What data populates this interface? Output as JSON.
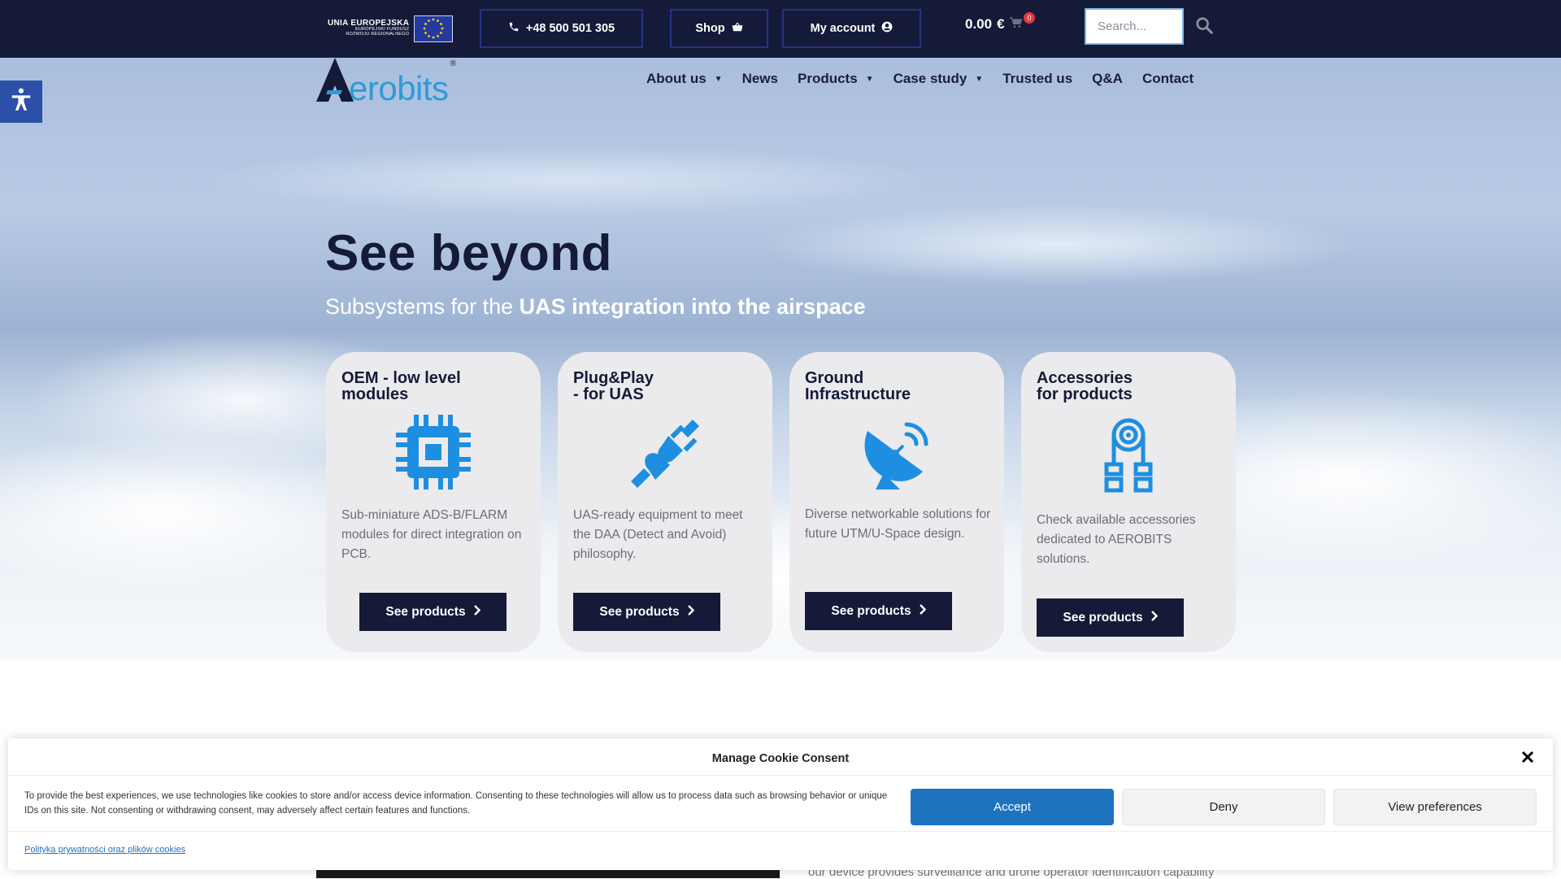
{
  "topbar": {
    "eu_title": "UNIA EUROPEJSKA",
    "eu_subtitle_1": "EUROPEJSKI FUNDUSZ",
    "eu_subtitle_2": "ROZWOJU REGIONALNEGO",
    "phone_label": "+48 500 501 305",
    "shop_label": "Shop",
    "account_label": "My account",
    "cart_total": "0.00",
    "cart_currency": "€",
    "cart_count": "0",
    "search_placeholder": "Search..."
  },
  "brand": {
    "logo_text": "erobits",
    "registered": "®"
  },
  "nav": [
    {
      "label": "About us",
      "has_dropdown": true
    },
    {
      "label": "News",
      "has_dropdown": false
    },
    {
      "label": "Products",
      "has_dropdown": true
    },
    {
      "label": "Case study",
      "has_dropdown": true
    },
    {
      "label": "Trusted us",
      "has_dropdown": false
    },
    {
      "label": "Q&A",
      "has_dropdown": false
    },
    {
      "label": "Contact",
      "has_dropdown": false
    }
  ],
  "hero": {
    "headline": "See beyond",
    "subline_prefix": "Subsystems for the ",
    "subline_bold": "UAS integration into the airspace"
  },
  "cards": [
    {
      "title_1": "OEM - low level",
      "title_2": "modules",
      "icon": "chip-icon",
      "desc": "Sub-miniature ADS-B/FLARM modules for direct integration on PCB.",
      "button": "See products"
    },
    {
      "title_1": "Plug&Play",
      "title_2": "- for UAS",
      "icon": "plug-icon",
      "desc": "UAS-ready equipment to meet the DAA (Detect and Avoid) philosophy.",
      "button": "See products"
    },
    {
      "title_1": "Ground",
      "title_2": "Infrastructure",
      "icon": "satellite-dish-icon",
      "desc": "Diverse networkable solutions for future UTM/U-Space design.",
      "button": "See products"
    },
    {
      "title_1": "Accessories",
      "title_2": "for products",
      "icon": "cable-icon",
      "desc": "Check available accessories dedicated to AEROBITS solutions.",
      "button": "See products"
    }
  ],
  "cookie": {
    "title": "Manage Cookie Consent",
    "text": "To provide the best experiences, we use technologies like cookies to store and/or access device information. Consenting to these technologies will allow us to process data such as browsing behavior or unique IDs on this site. Not consenting or withdrawing consent, may adversely affect certain features and functions.",
    "accept": "Accept",
    "deny": "Deny",
    "preferences": "View preferences",
    "policy_link": "Polityka prywatności oraz plików cookies"
  },
  "below": {
    "peek_text": "our device provides surveillance and drone operator identification capability"
  },
  "colors": {
    "navy": "#151a38",
    "accent_blue": "#2d9bd6",
    "button_blue": "#1e73be",
    "card_bg": "#ebebed"
  }
}
